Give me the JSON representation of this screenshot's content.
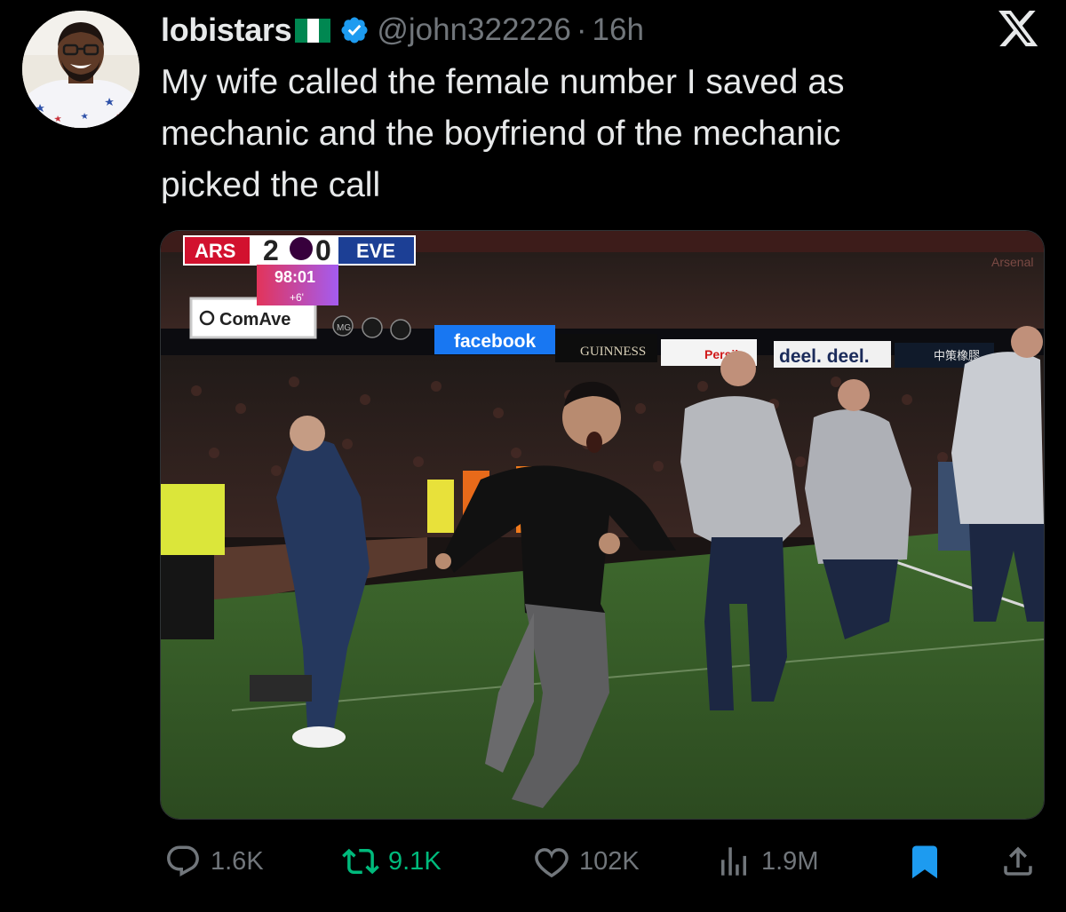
{
  "tweet": {
    "display_name": "lobistars",
    "flag_icon": "nigeria-flag-icon",
    "verified_icon": "verified-badge-icon",
    "handle": "@john322226",
    "separator": "·",
    "time": "16h",
    "platform_logo": "x-logo-icon",
    "text": "My wife called the female number I saved as\nmechanic and the boyfriend of the mechanic\npicked the call"
  },
  "media": {
    "scoreboard": {
      "home": "ARS",
      "home_score": "2",
      "away_score": "0",
      "away": "EVE",
      "clock": "98:01",
      "added_time": "+6'"
    },
    "ads": {
      "comave": "ComAve",
      "mg": "MG",
      "facebook": "facebook",
      "guinness": "GUINNESS",
      "persil": "Persil",
      "deel": "deel. deel.",
      "cn_text": "中策橡膠"
    },
    "stadium_text": "Arsenal"
  },
  "actions": {
    "reply": {
      "icon": "reply-icon",
      "count": "1.6K"
    },
    "repost": {
      "icon": "repost-icon",
      "count": "9.1K",
      "color": "#00ba7c"
    },
    "like": {
      "icon": "heart-icon",
      "count": "102K"
    },
    "views": {
      "icon": "views-chart-icon",
      "count": "1.9M"
    },
    "bookmark": {
      "icon": "bookmark-icon",
      "color": "#1d9bf0"
    },
    "share": {
      "icon": "share-icon"
    }
  },
  "colors": {
    "background": "#000000",
    "text": "#e7e9ea",
    "muted": "#71767b",
    "accent": "#1d9bf0",
    "verified": "#1d9bf0",
    "repost": "#00ba7c",
    "nigeria_green": "#008751"
  }
}
